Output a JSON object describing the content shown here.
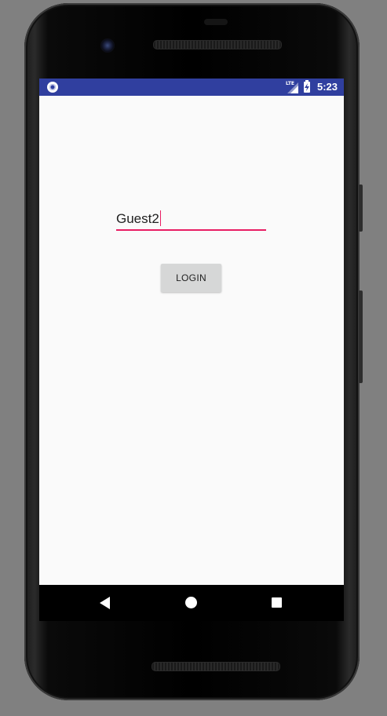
{
  "status_bar": {
    "network_label": "LTE",
    "time": "5:23",
    "color": "#303f9f"
  },
  "name_field": {
    "value": "Guest2",
    "underline_color": "#e91e63"
  },
  "login_button": {
    "label": "LOGIN"
  },
  "nav_bar": {
    "back_icon": "back-triangle",
    "home_icon": "home-circle",
    "recents_icon": "recents-square"
  }
}
